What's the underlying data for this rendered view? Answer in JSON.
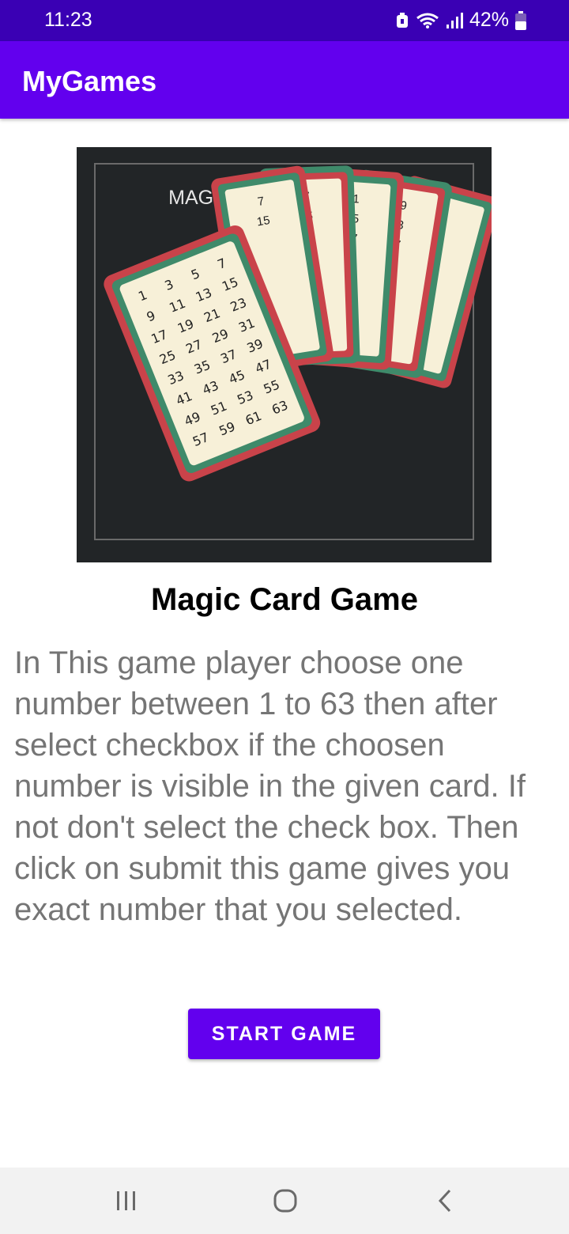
{
  "status_bar": {
    "time": "11:23",
    "battery_percent": "42%",
    "icons": [
      "alarm-icon",
      "wifi-icon",
      "signal-icon",
      "battery-icon"
    ]
  },
  "app_bar": {
    "title": "MyGames"
  },
  "hero_image": {
    "banner_text": "MAGIC NUMBER CARDS",
    "card_rows": [
      [
        "1",
        "3",
        "5",
        "7"
      ],
      [
        "9",
        "11",
        "13",
        "15"
      ],
      [
        "17",
        "19",
        "21",
        "23"
      ],
      [
        "25",
        "27",
        "29",
        "31"
      ],
      [
        "33",
        "35",
        "37",
        "39"
      ],
      [
        "41",
        "43",
        "45",
        "47"
      ],
      [
        "49",
        "51",
        "53",
        "55"
      ],
      [
        "57",
        "59",
        "61",
        "63"
      ]
    ]
  },
  "content": {
    "title": "Magic Card Game",
    "description": "In This game player choose one number between 1 to 63 then after select checkbox if the choosen number is visible in the given card. If not don't select the check box. Then click on submit this game gives you exact number that you selected."
  },
  "actions": {
    "start_label": "START GAME"
  },
  "nav_bar": {
    "icons": [
      "recent-apps-icon",
      "home-icon",
      "back-icon"
    ]
  },
  "colors": {
    "primary": "#6200ee",
    "status_bar": "#3a00b4",
    "image_bg": "#222527"
  }
}
